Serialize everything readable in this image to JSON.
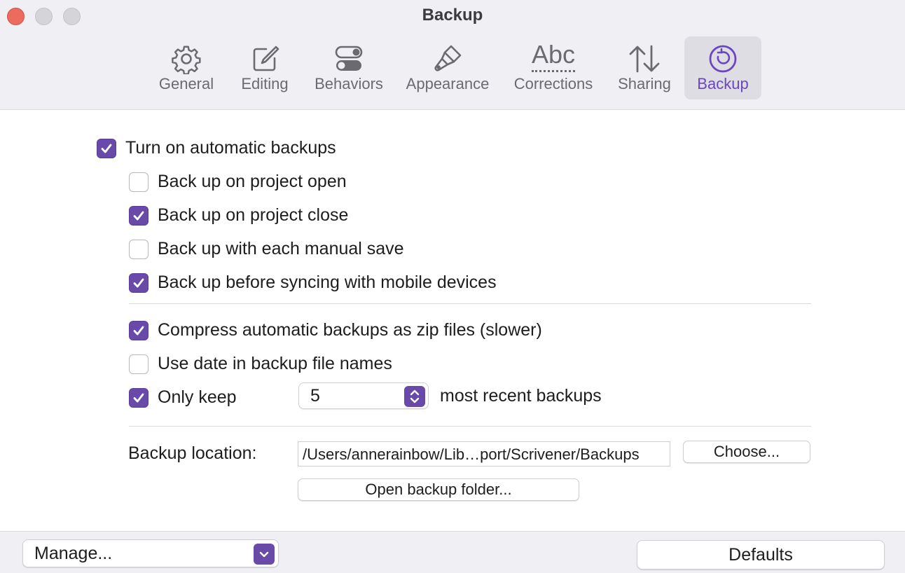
{
  "window": {
    "title": "Backup",
    "controls": [
      "close",
      "minimize",
      "maximize"
    ]
  },
  "toolbar": {
    "tabs": [
      {
        "label": "General",
        "icon": "gear-icon"
      },
      {
        "label": "Editing",
        "icon": "edit-icon"
      },
      {
        "label": "Behaviors",
        "icon": "toggles-icon"
      },
      {
        "label": "Appearance",
        "icon": "paintbrush-icon"
      },
      {
        "label": "Corrections",
        "icon": "abc-icon",
        "icon_text": "Abc"
      },
      {
        "label": "Sharing",
        "icon": "up-down-arrows-icon"
      },
      {
        "label": "Backup",
        "icon": "backup-icon",
        "active": true
      }
    ]
  },
  "options": {
    "auto_backups": {
      "label": "Turn on automatic backups",
      "checked": true
    },
    "on_open": {
      "label": "Back up on project open",
      "checked": false
    },
    "on_close": {
      "label": "Back up on project close",
      "checked": true
    },
    "manual_save": {
      "label": "Back up with each manual save",
      "checked": false
    },
    "before_sync": {
      "label": "Back up before syncing with mobile devices",
      "checked": true
    },
    "compress": {
      "label": "Compress automatic backups as zip files (slower)",
      "checked": true
    },
    "use_date": {
      "label": "Use date in backup file names",
      "checked": false
    },
    "only_keep": {
      "label": "Only keep",
      "checked": true,
      "value": "5",
      "suffix": "most recent backups"
    }
  },
  "location": {
    "label": "Backup location:",
    "path": "/Users/annerainbow/Lib…port/Scrivener/Backups",
    "choose_label": "Choose...",
    "open_folder_label": "Open backup folder..."
  },
  "footer": {
    "manage_label": "Manage...",
    "defaults_label": "Defaults"
  },
  "colors": {
    "accent": "#6a4aa8",
    "active_tab_text": "#6b46c1",
    "close": "#ed6a5e"
  }
}
